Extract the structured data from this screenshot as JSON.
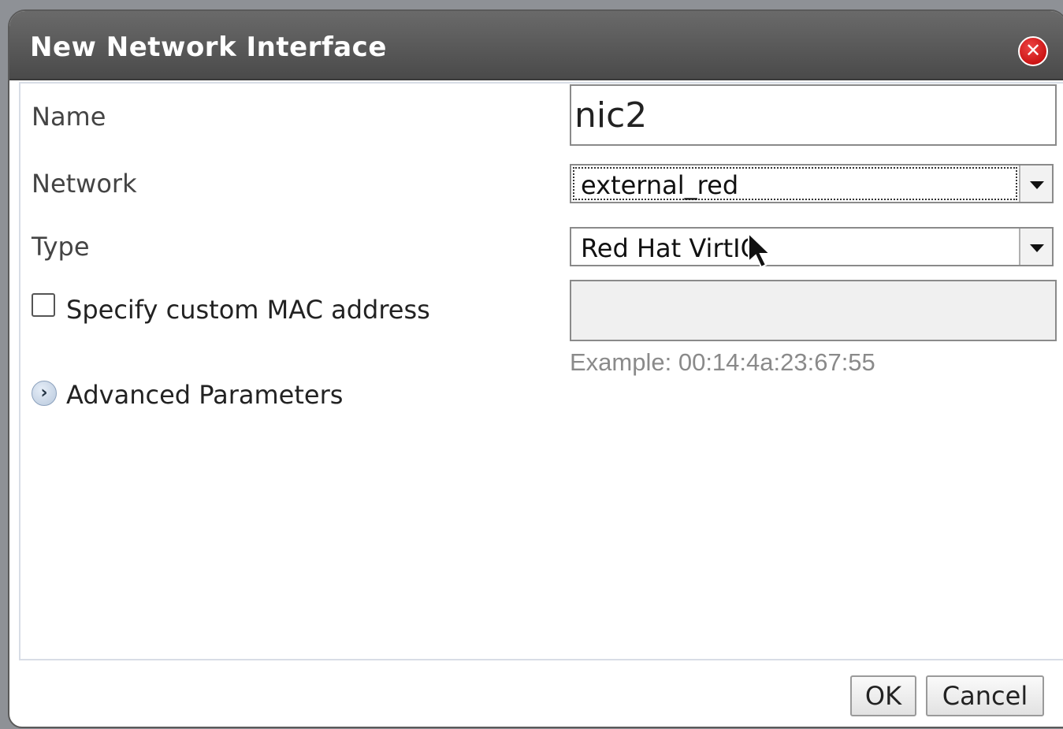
{
  "dialog": {
    "title": "New Network Interface",
    "close_icon": "close-icon"
  },
  "form": {
    "name_label": "Name",
    "name_value": "nic2",
    "network_label": "Network",
    "network_value": "external_red",
    "type_label": "Type",
    "type_value": "Red Hat VirtIO",
    "mac_checkbox_label": "Specify custom MAC address",
    "mac_checked": false,
    "mac_value": "",
    "mac_example": "Example: 00:14:4a:23:67:55",
    "advanced_label": "Advanced Parameters"
  },
  "buttons": {
    "ok": "OK",
    "cancel": "Cancel"
  },
  "colors": {
    "titlebar": "#4f4f4f",
    "close": "#cc1111"
  }
}
